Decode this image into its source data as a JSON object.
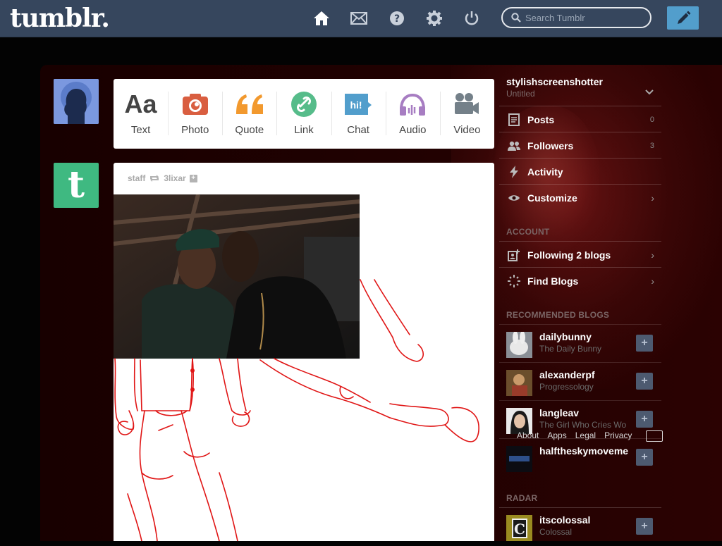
{
  "header": {
    "logo": "tumblr.",
    "nav": [
      {
        "name": "home-icon"
      },
      {
        "name": "mail-icon"
      },
      {
        "name": "help-icon"
      },
      {
        "name": "gear-icon"
      },
      {
        "name": "power-icon"
      }
    ],
    "search_placeholder": "Search Tumblr",
    "compose_icon": "pencil-icon",
    "bar_color": "#36465d",
    "compose_color": "#529ecc"
  },
  "post_types": [
    {
      "label": "Text",
      "icon": "Aa",
      "color": "#444444"
    },
    {
      "label": "Photo",
      "icon": "camera-icon",
      "color": "#d95e40"
    },
    {
      "label": "Quote",
      "icon": "quote-icon",
      "color": "#f2992e"
    },
    {
      "label": "Link",
      "icon": "link-icon",
      "color": "#56bc8a"
    },
    {
      "label": "Chat",
      "icon": "hi!",
      "color": "#529ecc"
    },
    {
      "label": "Audio",
      "icon": "headphones-icon",
      "color": "#a77dc2"
    },
    {
      "label": "Video",
      "icon": "video-camera-icon",
      "color": "#748089"
    }
  ],
  "post": {
    "author": "staff",
    "reblogged_from": "3lixar"
  },
  "sidebar": {
    "blog_name": "stylishscreenshotter",
    "blog_subtitle": "Untitled",
    "stats": [
      {
        "label": "Posts",
        "count": "0"
      },
      {
        "label": "Followers",
        "count": "3"
      },
      {
        "label": "Activity"
      },
      {
        "label": "Customize"
      }
    ],
    "account_heading": "ACCOUNT",
    "account": [
      {
        "label": "Following 2 blogs"
      },
      {
        "label": "Find Blogs"
      }
    ],
    "recommended_heading": "RECOMMENDED BLOGS",
    "recommended": [
      {
        "name": "dailybunny",
        "title": "The Daily Bunny"
      },
      {
        "name": "alexanderpf",
        "title": "Progressology"
      },
      {
        "name": "langleav",
        "title": "The Girl Who Cries Wo"
      },
      {
        "name": "halftheskymoveme",
        "title": ""
      }
    ],
    "footer_links": [
      "About",
      "Apps",
      "Legal",
      "Privacy"
    ],
    "radar_heading": "RADAR",
    "radar": {
      "name": "itscolossal",
      "title": "Colossal"
    }
  }
}
